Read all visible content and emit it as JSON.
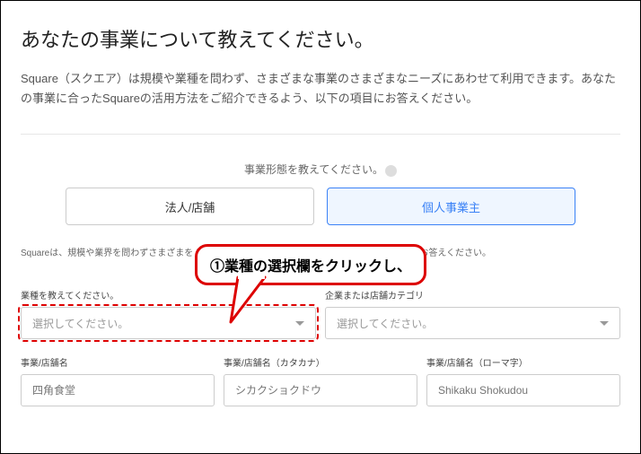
{
  "heading": "あなたの事業について教えてください。",
  "description": "Square（スクエア）は規模や業種を問わず、さまざまな事業のさまざまなニーズにあわせて利用できます。あなたの事業に合ったSquareの活用方法をご紹介できるよう、以下の項目にお答えください。",
  "form": {
    "business_form_label": "事業形態を教えてください。",
    "options": {
      "corporate": "法人/店舗",
      "sole": "個人事業主"
    },
    "subtext": "Squareは、規模や業界を問わずさまざまを                                                                                                         についてご紹介させていただきますので、以下の質問にお答えください。",
    "industry": {
      "label": "業種を教えてください。",
      "placeholder": "選択してください。"
    },
    "category": {
      "label": "企業または店舗カテゴリ",
      "placeholder": "選択してください。"
    },
    "name": {
      "label": "事業/店舗名",
      "placeholder": "四角食堂"
    },
    "name_kana": {
      "label": "事業/店舗名（カタカナ）",
      "placeholder": "シカクショクドウ"
    },
    "name_roma": {
      "label": "事業/店舗名（ローマ字）",
      "placeholder": "Shikaku Shokudou"
    }
  },
  "annotation": "①業種の選択欄をクリックし、"
}
